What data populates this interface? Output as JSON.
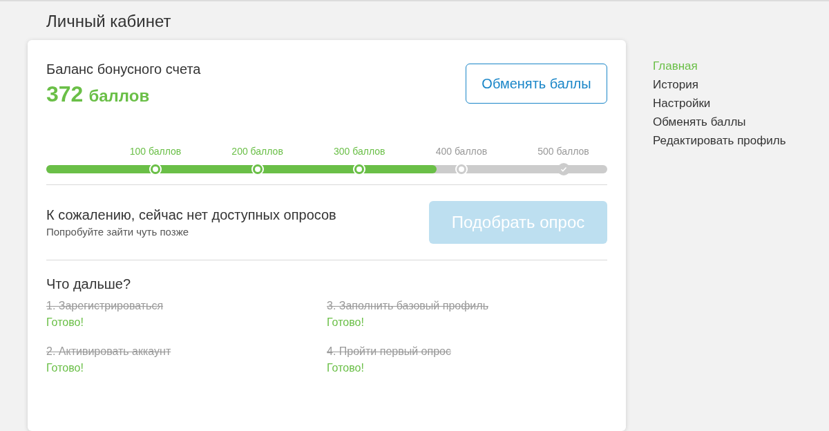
{
  "page_title": "Личный кабинет",
  "balance": {
    "label": "Баланс бонусного счета",
    "amount": "372",
    "unit": "баллов",
    "exchange_button": "Обменять баллы"
  },
  "progress": {
    "level": 0.696,
    "milestones": [
      {
        "label": "100 баллов",
        "reached": true,
        "kind": "ring"
      },
      {
        "label": "200 баллов",
        "reached": true,
        "kind": "ring"
      },
      {
        "label": "300 баллов",
        "reached": true,
        "kind": "ring"
      },
      {
        "label": "400 баллов",
        "reached": false,
        "kind": "ring"
      },
      {
        "label": "500 баллов",
        "reached": false,
        "kind": "check"
      }
    ]
  },
  "surveys": {
    "title": "К сожалению, сейчас нет доступных опросов",
    "subtitle": "Попробуйте зайти чуть позже",
    "button": {
      "label": "Подобрать опрос",
      "disabled": true
    }
  },
  "next_steps": {
    "title": "Что дальше?",
    "steps": [
      {
        "label": "1. Зарегистрироваться",
        "done": true,
        "status": "Готово!"
      },
      {
        "label": "2. Активировать аккаунт",
        "done": true,
        "status": "Готово!"
      },
      {
        "label": "3. Заполнить базовый профиль",
        "done": true,
        "status": "Готово!"
      },
      {
        "label": "4. Пройти первый опрос",
        "done": true,
        "status": "Готово!"
      }
    ]
  },
  "sidebar": {
    "items": [
      {
        "label": "Главная",
        "selected": true
      },
      {
        "label": "История",
        "selected": false
      },
      {
        "label": "Настройки",
        "selected": false
      },
      {
        "label": "Обменять баллы",
        "selected": false
      },
      {
        "label": "Редактировать профиль",
        "selected": false
      }
    ]
  }
}
